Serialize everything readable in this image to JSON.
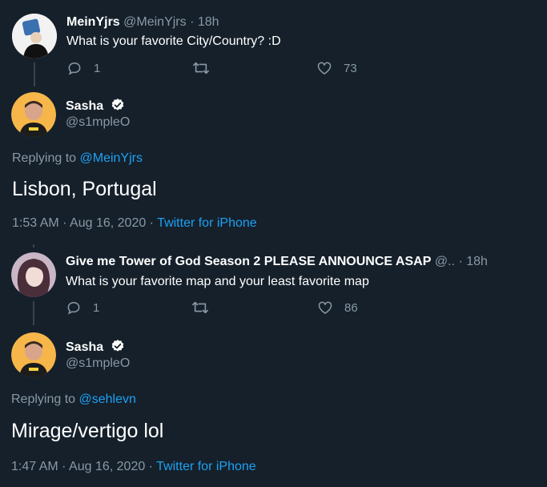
{
  "tweet1": {
    "name": "MeinYjrs",
    "handle": "@MeinYjrs",
    "time": "· 18h",
    "text": "What is your favorite City/Country? :D",
    "replies": "1",
    "likes": "73"
  },
  "reply1": {
    "name": "Sasha",
    "handle": "@s1mpleO",
    "replying_prefix": "Replying to",
    "replying_to": "@MeinYjrs",
    "text": "Lisbon, Portugal",
    "timestamp": "1:53 AM · Aug 16, 2020 ·",
    "source": "Twitter for iPhone"
  },
  "tweet2": {
    "name": "Give me Tower of God Season 2 PLEASE ANNOUNCE ASAP",
    "handle": "@..",
    "time": "· 18h",
    "text": "What is your favorite map and your least favorite map",
    "replies": "1",
    "likes": "86"
  },
  "reply2": {
    "name": "Sasha",
    "handle": "@s1mpleO",
    "replying_prefix": "Replying to",
    "replying_to": "@sehlevn",
    "text": "Mirage/vertigo lol",
    "timestamp": "1:47 AM · Aug 16, 2020 ·",
    "source": "Twitter for iPhone"
  },
  "colors": {
    "background": "#15202b",
    "accent": "#1da1f2",
    "muted": "#8899a6",
    "thread_line": "#38444d"
  },
  "icons": [
    "reply-icon",
    "retweet-icon",
    "like-icon",
    "verified-icon"
  ]
}
